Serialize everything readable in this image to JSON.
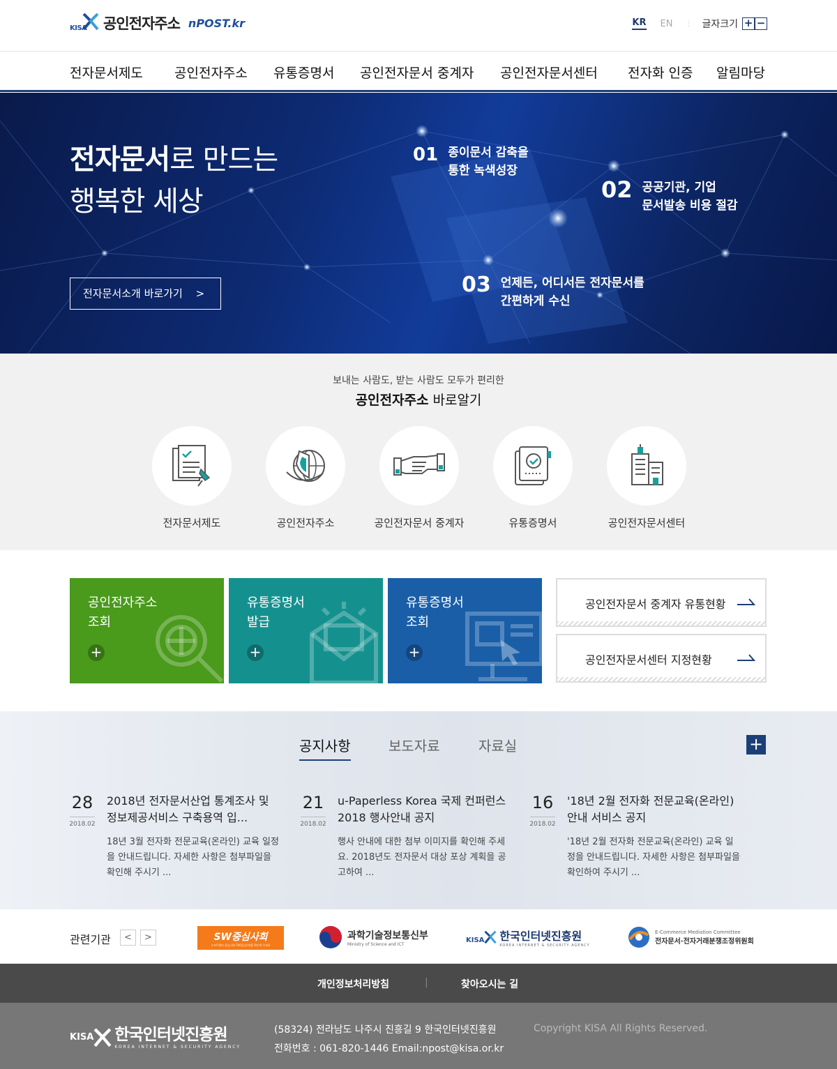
{
  "header": {
    "logo_org": "KISA",
    "logo_title": "공인전자주소",
    "logo_brand": "nPOST.kr",
    "lang_kr": "KR",
    "lang_en": "EN",
    "font_size_label": "글자크기",
    "font_plus": "+",
    "font_minus": "−"
  },
  "nav": {
    "items": [
      "전자문서제도",
      "공인전자주소",
      "유통증명서",
      "공인전자문서 중계자",
      "공인전자문서센터",
      "전자화 인증",
      "알림마당"
    ]
  },
  "hero": {
    "title_bold": "전자문서",
    "title_rest": "로 만드는",
    "title_line2": "행복한 세상",
    "button_label": "전자문서소개 바로가기",
    "button_arrow": ">",
    "features": [
      {
        "num": "01",
        "line1": "종이문서 감축을",
        "line2": "통한 녹색성장"
      },
      {
        "num": "02",
        "line1": "공공기관, 기업",
        "line2": "문서발송 비용 절감"
      },
      {
        "num": "03",
        "line1": "언제든, 어디서든  전자문서를",
        "line2": "간편하게 수신"
      }
    ]
  },
  "know": {
    "subtitle": "보내는 사람도, 받는 사람도 모두가 편리한",
    "title_bold": "공인전자주소",
    "title_rest": " 바로알기",
    "items": [
      {
        "label": "전자문서제도",
        "icon": "document-pin-icon"
      },
      {
        "label": "공인전자주소",
        "icon": "shield-globe-icon"
      },
      {
        "label": "공인전자문서 중계자",
        "icon": "handshake-icon"
      },
      {
        "label": "유통증명서",
        "icon": "certificate-check-icon"
      },
      {
        "label": "공인전자문서센터",
        "icon": "building-icon"
      }
    ]
  },
  "quick": {
    "boxes": [
      {
        "line1": "공인전자주소",
        "line2": "조회",
        "color": "#4a9a1c"
      },
      {
        "line1": "유통증명서",
        "line2": "발급",
        "color": "#14918e"
      },
      {
        "line1": "유통증명서",
        "line2": "조회",
        "color": "#1a5ea8"
      }
    ],
    "plus": "+",
    "stats": [
      "공인전자문서 중계자 유통현황",
      "공인전자문서센터 지정현황"
    ]
  },
  "notice": {
    "tabs": [
      "공지사항",
      "보도자료",
      "자료실"
    ],
    "more": "+",
    "items": [
      {
        "day": "28",
        "ym": "2018.02",
        "title": "2018년 전자문서산업 통계조사 및 정보제공서비스 구축용역 입...",
        "body": "18년 3월 전자화 전문교육(온라인) 교육 일정을 안내드립니다. 자세한 사항은 첨부파일을 확인해 주시기 ..."
      },
      {
        "day": "21",
        "ym": "2018.02",
        "title": "u-Paperless Korea 국제 컨퍼런스 2018 행사안내 공지",
        "body": "행사 안내에 대한 첨부 이미지를 확인해 주세요. 2018년도 전자문서 대상 포상 계획을 공고하여  ..."
      },
      {
        "day": "16",
        "ym": "2018.02",
        "title": "'18년 2월 전자화 전문교육(온라인) 안내 서비스 공지",
        "body": "'18년 2월 전자화 전문교육(온라인) 교육 일정을 안내드립니다. 자세한 사항은 첨부파일을 확인하여 주시기  ..."
      }
    ]
  },
  "related": {
    "label": "관련기관",
    "prev": "<",
    "next": ">",
    "logos": [
      {
        "text": "SW중심사회",
        "sub": "소프트웨어 중심사회 SW중심사회를 확인해 보세요"
      },
      {
        "text": "과학기술정보통신부",
        "sub": "Ministry of Science and ICT"
      },
      {
        "text": "한국인터넷진흥원",
        "sub": "KOREA INTERNET & SECURITY AGENCY",
        "org": "KISA"
      },
      {
        "text": "전자문서·전자거래분쟁조정위원회",
        "sub": "E-Commerce Mediation Committee"
      }
    ]
  },
  "footer": {
    "links": [
      "개인정보처리방침",
      "찾아오시는 길"
    ],
    "sep": "|",
    "org": "KISA",
    "org_name": "한국인터넷진흥원",
    "org_sub": "KOREA INTERNET & SECURITY AGENCY",
    "address": "(58324) 전라남도 나주시 진흥길 9 한국인터넷진흥원",
    "contact": "전화번호 : 061-820-1446  Email:npost@kisa.or.kr",
    "copyright": "Copyright KISA All Rights Reserved."
  }
}
